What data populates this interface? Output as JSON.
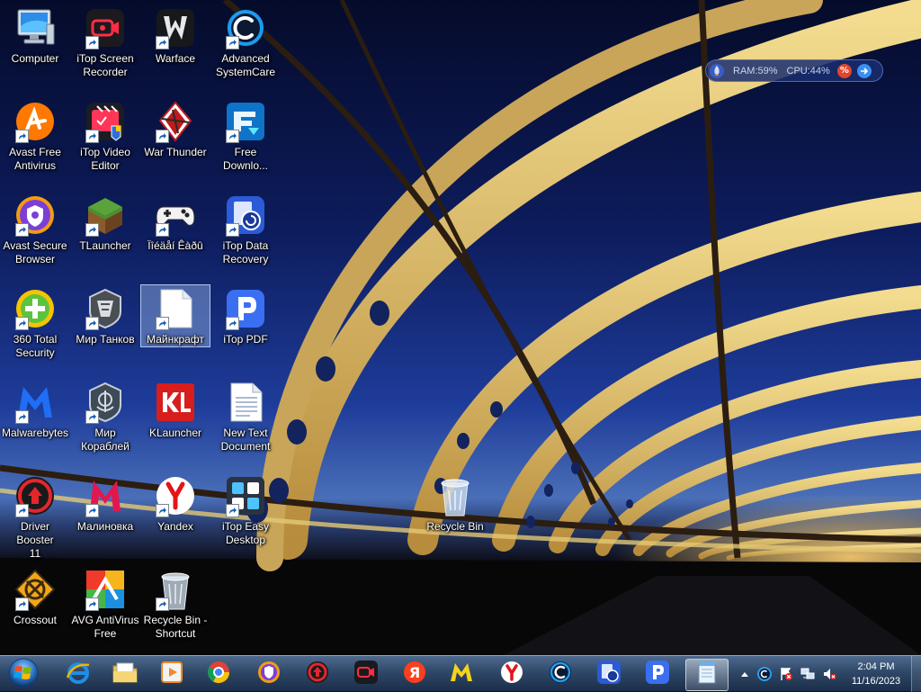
{
  "desktop": {
    "icons": [
      {
        "label": "Computer",
        "icon": "computer-icon"
      },
      {
        "label": "iTop Screen\nRecorder",
        "icon": "itop-screen-recorder-icon"
      },
      {
        "label": "Warface",
        "icon": "warface-icon"
      },
      {
        "label": "Advanced\nSystemCare",
        "icon": "advanced-systemcare-icon"
      },
      {
        "label": "Avast Free\nAntivirus",
        "icon": "avast-icon"
      },
      {
        "label": "iTop Video\nEditor",
        "icon": "itop-video-editor-icon"
      },
      {
        "label": "War Thunder",
        "icon": "war-thunder-icon"
      },
      {
        "label": "Free\nDownlo...",
        "icon": "free-download-icon"
      },
      {
        "label": "Avast Secure\nBrowser",
        "icon": "avast-secure-browser-icon"
      },
      {
        "label": "TLauncher",
        "icon": "tlauncher-icon"
      },
      {
        "label": "Ïîéäåí Êàðû",
        "icon": "gamepad-icon"
      },
      {
        "label": "iTop Data\nRecovery",
        "icon": "itop-data-recovery-icon"
      },
      {
        "label": "360 Total\nSecurity",
        "icon": "360-total-security-icon"
      },
      {
        "label": "Мир Танков",
        "icon": "mir-tankov-icon"
      },
      {
        "label": "Майнкрафт",
        "icon": "blank-file-icon"
      },
      {
        "label": "iTop PDF",
        "icon": "itop-pdf-icon"
      },
      {
        "label": "Malwarebytes",
        "icon": "malwarebytes-icon"
      },
      {
        "label": "Мир\nКораблей",
        "icon": "mir-korabley-icon"
      },
      {
        "label": "KLauncher",
        "icon": "klauncher-icon"
      },
      {
        "label": "New Text\nDocument",
        "icon": "text-document-icon"
      },
      {
        "label": "Driver Booster\n11",
        "icon": "driver-booster-icon"
      },
      {
        "label": "Малиновка",
        "icon": "malinovka-icon"
      },
      {
        "label": "Yandex",
        "icon": "yandex-browser-icon"
      },
      {
        "label": "iTop Easy\nDesktop",
        "icon": "itop-easy-desktop-icon"
      },
      {
        "label": "Crossout",
        "icon": "crossout-icon"
      },
      {
        "label": "AVG AntiVirus\nFree",
        "icon": "avg-icon"
      },
      {
        "label": "Recycle Bin -\nShortcut",
        "icon": "recycle-bin-icon"
      },
      {
        "label": "Recycle Bin",
        "icon": "recycle-bin-icon"
      }
    ]
  },
  "gadget": {
    "ram": "RAM:59%",
    "cpu": "CPU:44%"
  },
  "taskbar": {
    "pinned": [
      "internet-explorer-icon",
      "windows-explorer-icon",
      "media-player-icon",
      "chrome-icon",
      "avast-browser-icon",
      "driver-booster-icon",
      "itop-screen-recorder-icon",
      "yandex-icon",
      "malinovka-icon",
      "yandex-browser-icon",
      "advanced-systemcare-icon",
      "itop-data-recovery-icon",
      "itop-pdf-icon",
      "notepad-icon"
    ],
    "clock": {
      "time": "2:04 PM",
      "date": "11/16/2023"
    }
  },
  "colors": {
    "taskbar": "#2f4868",
    "selection": "#96b9eb",
    "sky": "#1e3c9a",
    "bridge": "#e8cf7a"
  }
}
